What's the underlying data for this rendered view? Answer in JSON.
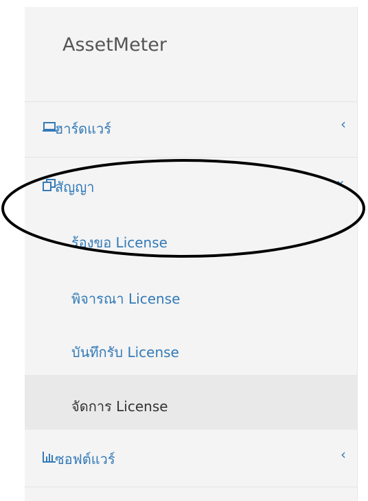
{
  "brand": {
    "title": "AssetMeter"
  },
  "nav": {
    "hardware": {
      "label": "ฮาร์ดแวร์",
      "icon": "laptop-icon",
      "chevron": "‹"
    },
    "contract": {
      "label": "สัญญา",
      "icon": "copy-icon",
      "chevron": "⌄"
    },
    "software": {
      "label": "ซอฟต์แวร์",
      "icon": "bar-chart-icon",
      "chevron": "‹"
    }
  },
  "submenu": [
    {
      "label": "ร้องขอ License"
    },
    {
      "label": "พิจารณา License"
    },
    {
      "label": "บันทึกรับ License"
    },
    {
      "label": "จัดการ License",
      "active": true
    }
  ],
  "colors": {
    "link": "#337ab7",
    "sidebar_bg": "#f4f4f4",
    "active_bg": "#e9e9e9",
    "brand": "#555555"
  }
}
